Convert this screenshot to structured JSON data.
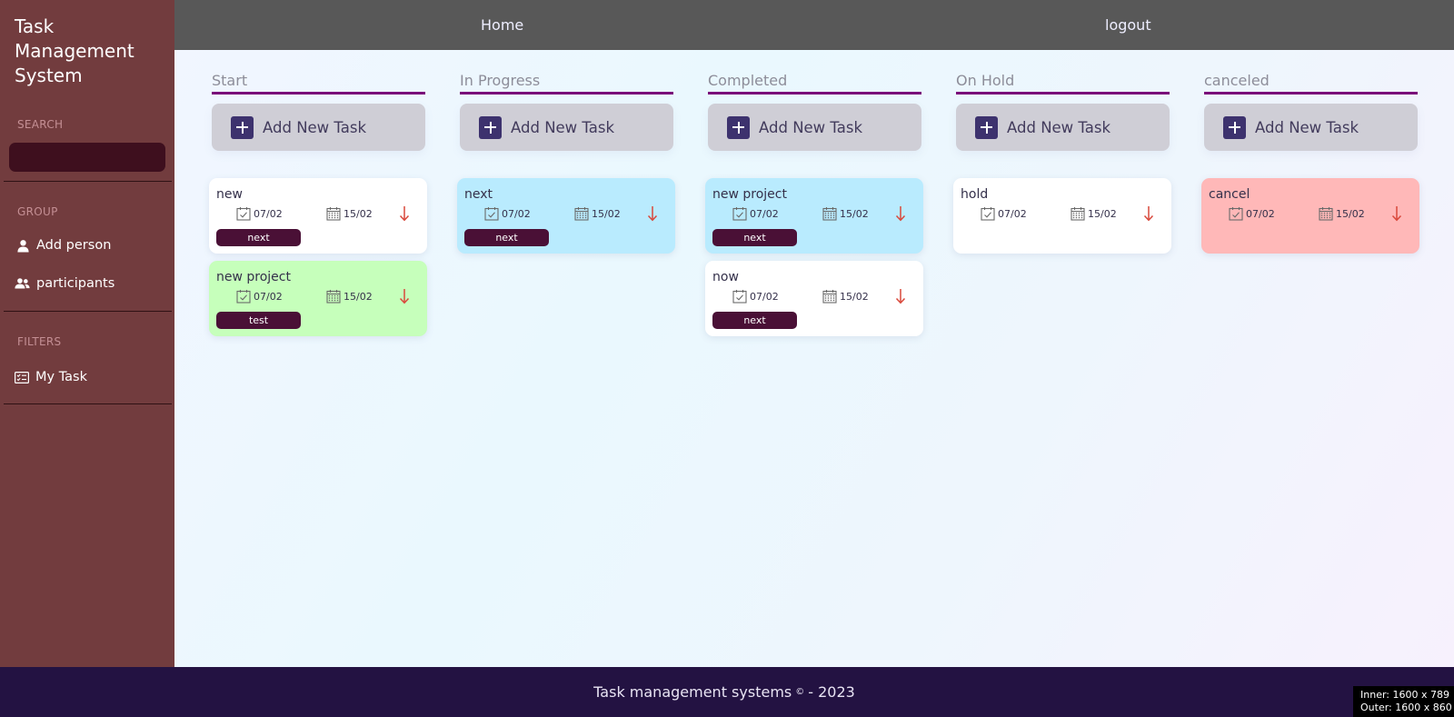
{
  "sidebar": {
    "brand": [
      "Task",
      "Management",
      "System"
    ],
    "search_label": "SEARCH",
    "search_value": "",
    "group_label": "GROUP",
    "add_person": "Add person",
    "participants": "participants",
    "filters_label": "FILTERS",
    "my_task": "My Task"
  },
  "header": {
    "home": "Home",
    "logout": "logout"
  },
  "board": {
    "add_label": "Add New Task",
    "columns": [
      {
        "title": "Start",
        "cards": [
          {
            "title": "new",
            "start": "07/02",
            "end": "15/02",
            "tag": "next",
            "bg": "#ffffff"
          },
          {
            "title": "new project",
            "start": "07/02",
            "end": "15/02",
            "tag": "test",
            "bg": "#c6ffbb"
          }
        ]
      },
      {
        "title": "In Progress",
        "cards": [
          {
            "title": "next",
            "start": "07/02",
            "end": "15/02",
            "tag": "next",
            "bg": "#b9ebfe"
          }
        ]
      },
      {
        "title": "Completed",
        "cards": [
          {
            "title": "new project",
            "start": "07/02",
            "end": "15/02",
            "tag": "next",
            "bg": "#b9ebfe"
          },
          {
            "title": "now",
            "start": "07/02",
            "end": "15/02",
            "tag": "next",
            "bg": "#ffffff"
          }
        ]
      },
      {
        "title": "On Hold",
        "cards": [
          {
            "title": "hold",
            "start": "07/02",
            "end": "15/02",
            "tag": "",
            "bg": "#ffffff"
          }
        ]
      },
      {
        "title": "canceled",
        "cards": [
          {
            "title": "cancel",
            "start": "07/02",
            "end": "15/02",
            "tag": "",
            "bg": "#ffb8b8"
          }
        ]
      }
    ]
  },
  "footer": {
    "text_before": "Task management systems",
    "copyright_symbol": "©",
    "text_after": "- 2023"
  },
  "viewport": {
    "inner": "Inner: 1600 x 789",
    "outer": "Outer: 1600 x 860"
  },
  "colors": {
    "sidebar_bg": "#723c3e",
    "header_bg": "#585858",
    "footer_bg": "#231242",
    "accent_line": "#7a0e7a",
    "tag_bg": "#4a1036",
    "plus_bg": "#3d326e",
    "arrow": "#d9483b"
  }
}
